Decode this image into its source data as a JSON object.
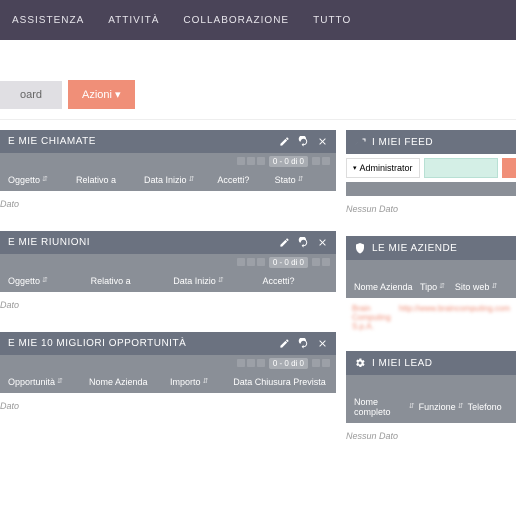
{
  "nav": {
    "items": [
      "ASSISTENZA",
      "ATTIVITÀ",
      "COLLABORAZIONE",
      "TUTTO"
    ]
  },
  "subbar": {
    "tab": "oard",
    "actions": "Azioni ▾"
  },
  "left_panels": [
    {
      "title": "E MIE CHIAMATE",
      "pager": "0 - 0 di 0",
      "columns": [
        "Oggetto",
        "Relativo a",
        "Data Inizio",
        "Accetti?",
        "Stato"
      ],
      "no_data": "Dato"
    },
    {
      "title": "E MIE RIUNIONI",
      "pager": "0 - 0 di 0",
      "columns": [
        "Oggetto",
        "Relativo a",
        "Data Inizio",
        "Accetti?"
      ],
      "no_data": "Dato"
    },
    {
      "title": "E MIE 10 MIGLIORI OPPORTUNITÀ",
      "pager": "0 - 0 di 0",
      "columns": [
        "Opportunità",
        "Nome Azienda",
        "Importo",
        "Data Chiusura Prevista"
      ],
      "no_data": "Dato"
    }
  ],
  "feed": {
    "title": "I MIEI FEED",
    "user_caret": "▾",
    "user": "Administrator",
    "no_data": "Nessun Dato"
  },
  "aziende": {
    "title": "LE MIE AZIENDE",
    "columns": [
      "Nome Azienda",
      "Tipo",
      "Sito web"
    ],
    "row_name": "Brain Computing S.p.A.",
    "row_link": "http://www.braincomputing.com"
  },
  "lead": {
    "title": "I MIEI LEAD",
    "columns": [
      "Nome completo",
      "Funzione",
      "Telefono"
    ],
    "no_data": "Nessun Dato"
  },
  "sort_glyph": "⇵"
}
